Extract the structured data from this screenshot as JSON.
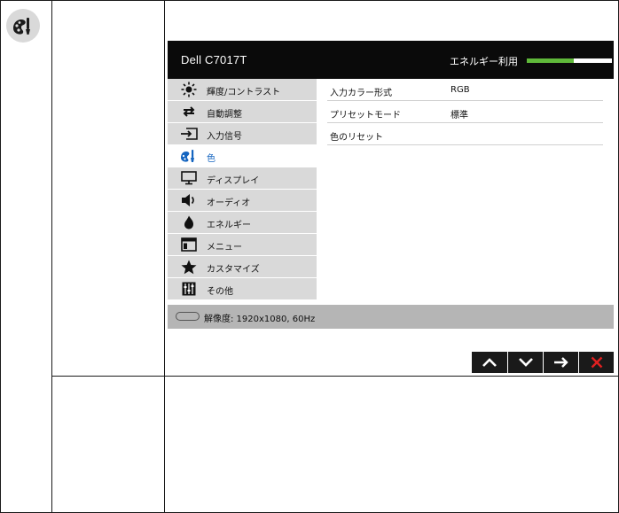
{
  "osd": {
    "model": "Dell C7017T",
    "energy_label": "エネルギー利用",
    "energy_level": 0.55,
    "energy_color": "#5fb93a",
    "menu": [
      {
        "label": "輝度/コントラスト",
        "icon": "brightness-icon"
      },
      {
        "label": "自動調整",
        "icon": "auto-adjust-icon"
      },
      {
        "label": "入力信号",
        "icon": "input-source-icon"
      },
      {
        "label": "色",
        "icon": "color-icon",
        "active": true
      },
      {
        "label": "ディスプレイ",
        "icon": "monitor-icon"
      },
      {
        "label": "オーディオ",
        "icon": "speaker-icon"
      },
      {
        "label": "エネルギー",
        "icon": "flame-icon"
      },
      {
        "label": "メニュー",
        "icon": "menu-window-icon"
      },
      {
        "label": "カスタマイズ",
        "icon": "star-icon"
      },
      {
        "label": "その他",
        "icon": "sliders-icon"
      }
    ],
    "submenu": [
      {
        "name": "入力カラー形式",
        "value": "RGB"
      },
      {
        "name": "プリセットモード",
        "value": "標準"
      },
      {
        "name": "色のリセット",
        "value": ""
      }
    ],
    "resolution": "解像度: 1920x1080, 60Hz"
  },
  "nav_buttons": [
    {
      "name": "up-button",
      "icon": "chevron-up-icon"
    },
    {
      "name": "down-button",
      "icon": "chevron-down-icon"
    },
    {
      "name": "right-button",
      "icon": "arrow-right-icon"
    },
    {
      "name": "exit-button",
      "icon": "close-icon",
      "color": "#e02020"
    }
  ]
}
